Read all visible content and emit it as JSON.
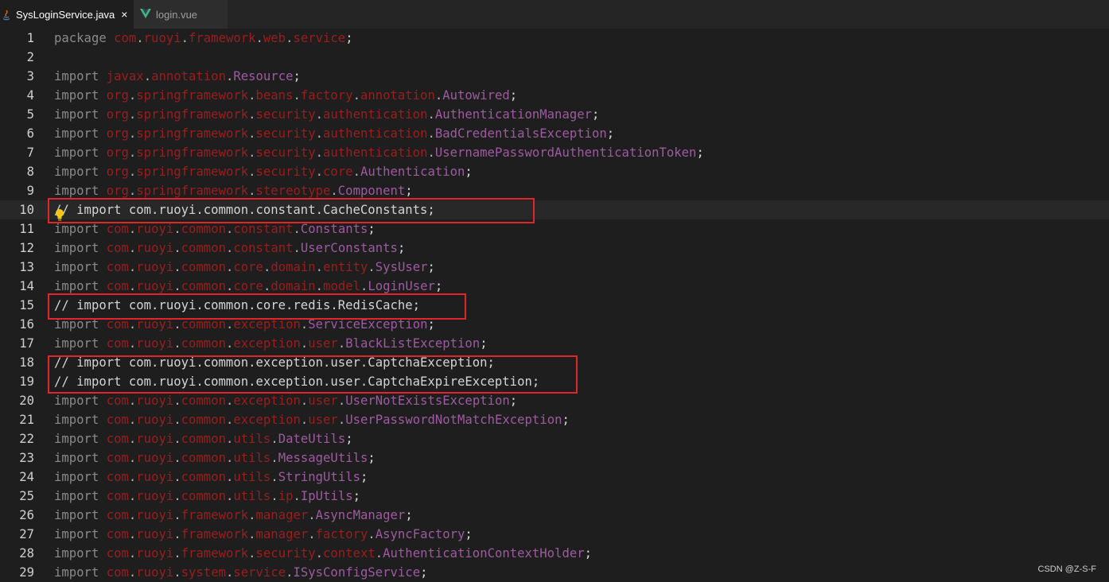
{
  "tabs": [
    {
      "label": "SysLoginService.java",
      "icon": "java-icon",
      "close": "×",
      "active": true
    },
    {
      "label": "login.vue",
      "icon": "vue-icon",
      "active": false
    }
  ],
  "colors": {
    "background": "#1e1e1e",
    "keyword": "#8a8a8a",
    "package": "#9b1d1d",
    "class": "#9e5aa0",
    "highlight_box": "#e0262b",
    "vue_green": "#41b883"
  },
  "editor": {
    "lines": [
      {
        "n": "1",
        "kind": "pkg",
        "kw": "package",
        "parts": [
          "com",
          "ruoyi",
          "framework",
          "web",
          "service"
        ],
        "cls": ""
      },
      {
        "n": "2",
        "kind": "blank"
      },
      {
        "n": "3",
        "kind": "imp",
        "kw": "import",
        "parts": [
          "javax",
          "annotation"
        ],
        "cls": "Resource"
      },
      {
        "n": "4",
        "kind": "imp",
        "kw": "import",
        "parts": [
          "org",
          "springframework",
          "beans",
          "factory",
          "annotation"
        ],
        "cls": "Autowired"
      },
      {
        "n": "5",
        "kind": "imp",
        "kw": "import",
        "parts": [
          "org",
          "springframework",
          "security",
          "authentication"
        ],
        "cls": "AuthenticationManager"
      },
      {
        "n": "6",
        "kind": "imp",
        "kw": "import",
        "parts": [
          "org",
          "springframework",
          "security",
          "authentication"
        ],
        "cls": "BadCredentialsException"
      },
      {
        "n": "7",
        "kind": "imp",
        "kw": "import",
        "parts": [
          "org",
          "springframework",
          "security",
          "authentication"
        ],
        "cls": "UsernamePasswordAuthenticationToken"
      },
      {
        "n": "8",
        "kind": "imp",
        "kw": "import",
        "parts": [
          "org",
          "springframework",
          "security",
          "core"
        ],
        "cls": "Authentication"
      },
      {
        "n": "9",
        "kind": "imp",
        "kw": "import",
        "parts": [
          "org",
          "springframework",
          "stereotype"
        ],
        "cls": "Component"
      },
      {
        "n": "10",
        "kind": "comment",
        "text": "// import com.ruoyi.common.constant.CacheConstants;"
      },
      {
        "n": "11",
        "kind": "imp",
        "kw": "import",
        "parts": [
          "com",
          "ruoyi",
          "common",
          "constant"
        ],
        "cls": "Constants"
      },
      {
        "n": "12",
        "kind": "imp",
        "kw": "import",
        "parts": [
          "com",
          "ruoyi",
          "common",
          "constant"
        ],
        "cls": "UserConstants"
      },
      {
        "n": "13",
        "kind": "imp",
        "kw": "import",
        "parts": [
          "com",
          "ruoyi",
          "common",
          "core",
          "domain",
          "entity"
        ],
        "cls": "SysUser"
      },
      {
        "n": "14",
        "kind": "imp",
        "kw": "import",
        "parts": [
          "com",
          "ruoyi",
          "common",
          "core",
          "domain",
          "model"
        ],
        "cls": "LoginUser"
      },
      {
        "n": "15",
        "kind": "comment",
        "text": "// import com.ruoyi.common.core.redis.RedisCache;"
      },
      {
        "n": "16",
        "kind": "imp",
        "kw": "import",
        "parts": [
          "com",
          "ruoyi",
          "common",
          "exception"
        ],
        "cls": "ServiceException"
      },
      {
        "n": "17",
        "kind": "imp",
        "kw": "import",
        "parts": [
          "com",
          "ruoyi",
          "common",
          "exception",
          "user"
        ],
        "cls": "BlackListException"
      },
      {
        "n": "18",
        "kind": "comment",
        "text": "// import com.ruoyi.common.exception.user.CaptchaException;"
      },
      {
        "n": "19",
        "kind": "comment",
        "text": "// import com.ruoyi.common.exception.user.CaptchaExpireException;"
      },
      {
        "n": "20",
        "kind": "imp",
        "kw": "import",
        "parts": [
          "com",
          "ruoyi",
          "common",
          "exception",
          "user"
        ],
        "cls": "UserNotExistsException"
      },
      {
        "n": "21",
        "kind": "imp",
        "kw": "import",
        "parts": [
          "com",
          "ruoyi",
          "common",
          "exception",
          "user"
        ],
        "cls": "UserPasswordNotMatchException"
      },
      {
        "n": "22",
        "kind": "imp",
        "kw": "import",
        "parts": [
          "com",
          "ruoyi",
          "common",
          "utils"
        ],
        "cls": "DateUtils"
      },
      {
        "n": "23",
        "kind": "imp",
        "kw": "import",
        "parts": [
          "com",
          "ruoyi",
          "common",
          "utils"
        ],
        "cls": "MessageUtils"
      },
      {
        "n": "24",
        "kind": "imp",
        "kw": "import",
        "parts": [
          "com",
          "ruoyi",
          "common",
          "utils"
        ],
        "cls": "StringUtils"
      },
      {
        "n": "25",
        "kind": "imp",
        "kw": "import",
        "parts": [
          "com",
          "ruoyi",
          "common",
          "utils",
          "ip"
        ],
        "cls": "IpUtils"
      },
      {
        "n": "26",
        "kind": "imp",
        "kw": "import",
        "parts": [
          "com",
          "ruoyi",
          "framework",
          "manager"
        ],
        "cls": "AsyncManager"
      },
      {
        "n": "27",
        "kind": "imp",
        "kw": "import",
        "parts": [
          "com",
          "ruoyi",
          "framework",
          "manager",
          "factory"
        ],
        "cls": "AsyncFactory"
      },
      {
        "n": "28",
        "kind": "imp",
        "kw": "import",
        "parts": [
          "com",
          "ruoyi",
          "framework",
          "security",
          "context"
        ],
        "cls": "AuthenticationContextHolder"
      },
      {
        "n": "29",
        "kind": "imp",
        "kw": "import",
        "parts": [
          "com",
          "ruoyi",
          "system",
          "service"
        ],
        "cls": "ISysConfigService"
      }
    ]
  },
  "watermark": "CSDN @Z-S-F"
}
